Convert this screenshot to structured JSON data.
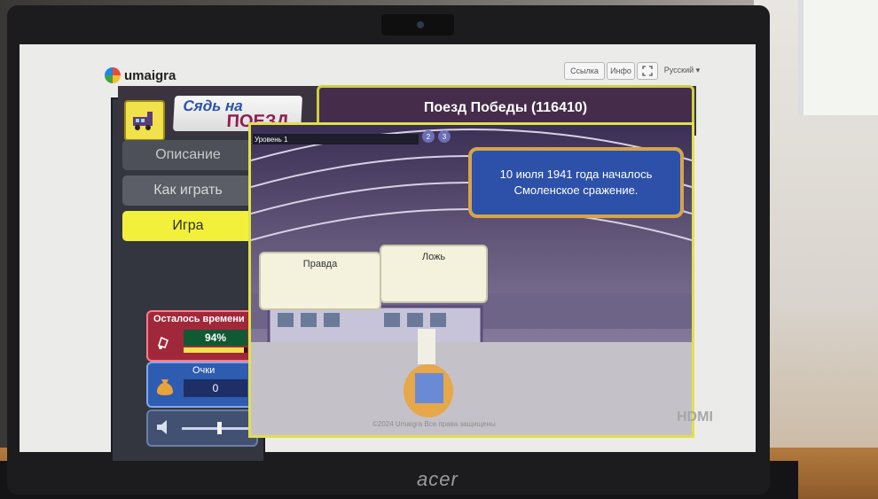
{
  "header": {
    "logo_text": "umaigra",
    "link_button": "Ссылка",
    "info_button": "Инфо",
    "language": "Русский ▾"
  },
  "game": {
    "title_logo_line1": "Сядь на",
    "title_logo_line2": "ПОЕЗД",
    "title": "Поезд Победы (116410)",
    "level_label": "Уровень 1",
    "level_dots": [
      "2",
      "3"
    ]
  },
  "menu": {
    "items": [
      {
        "label": "Описание"
      },
      {
        "label": "Как играть"
      },
      {
        "label": "Игра"
      }
    ]
  },
  "timer": {
    "title": "Осталось времени",
    "value": "94%",
    "fraction": 0.94
  },
  "score": {
    "label": "Очки",
    "value": "0"
  },
  "question": {
    "text": "10 июля 1941 года началось Смоленское сражение."
  },
  "answers": [
    {
      "label": "Правда"
    },
    {
      "label": "Ложь"
    }
  ],
  "footer": {
    "text": "©2024 Umaigra Все права защищены"
  },
  "device": {
    "brand": "acer",
    "port_label": "HDMI"
  }
}
